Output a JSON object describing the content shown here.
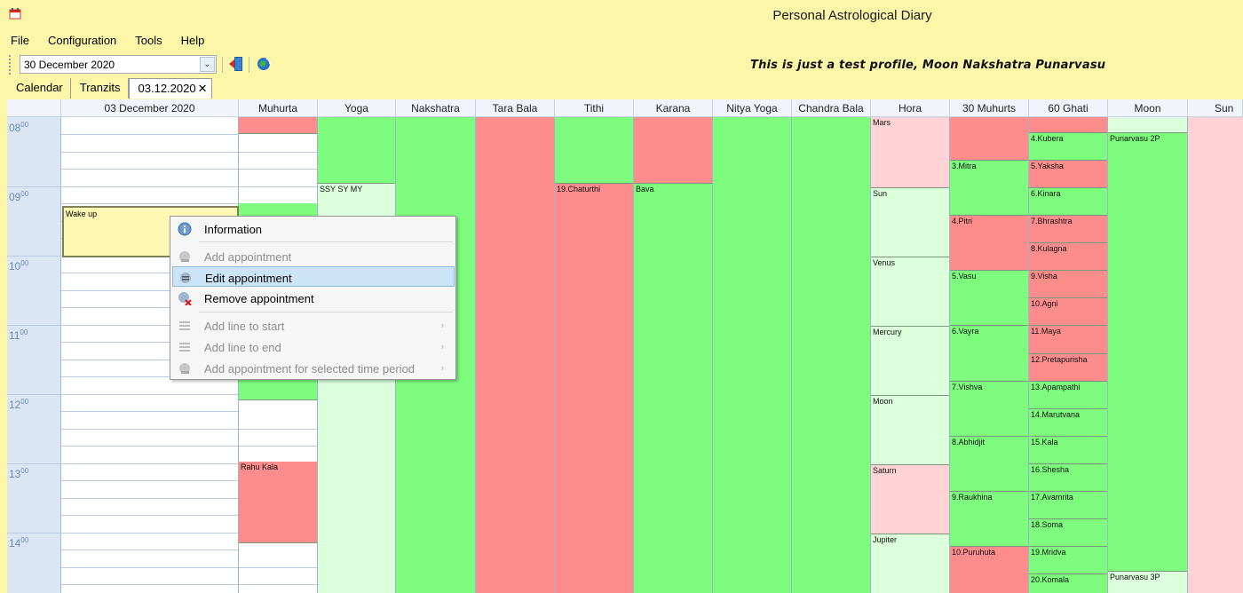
{
  "window": {
    "title": "Personal Astrological Diary"
  },
  "menu": [
    "File",
    "Configuration",
    "Tools",
    "Help"
  ],
  "toolbar": {
    "date_value": "30 December 2020",
    "drop_glyph": "⌄"
  },
  "profile_note": "This is just a test profile, Moon Nakshatra Punarvasu",
  "tabs": [
    {
      "label": "Calendar",
      "active": false
    },
    {
      "label": "Tranzits",
      "active": false
    },
    {
      "label": "03.12.2020",
      "active": true,
      "close": "✕"
    }
  ],
  "columns": {
    "date": "03 December 2020",
    "muhurta": "Muhurta",
    "yoga": "Yoga",
    "nakshatra": "Nakshatra",
    "tara_bala": "Tara Bala",
    "tithi": "Tithi",
    "karana": "Karana",
    "nitya_yoga": "Nitya Yoga",
    "chandra_bala": "Chandra Bala",
    "hora": "Hora",
    "muhurts_30": "30 Muhurts",
    "ghati_60": "60 Ghati",
    "moon": "Moon",
    "sun": "Sun"
  },
  "hours": [
    {
      "h": "08",
      "m": "00"
    },
    {
      "h": "09",
      "m": "00"
    },
    {
      "h": "10",
      "m": "00"
    },
    {
      "h": "11",
      "m": "00"
    },
    {
      "h": "12",
      "m": "00"
    },
    {
      "h": "13",
      "m": "00"
    },
    {
      "h": "14",
      "m": "00"
    }
  ],
  "appointment": {
    "label": "Wake up"
  },
  "cells": {
    "muhurta_rahu": "Rahu Kala",
    "yoga": "SSY SY MY",
    "tithi": "19.Chaturthi",
    "karana": "Bava",
    "hora": [
      "Mars",
      "Sun",
      "Venus",
      "Mercury",
      "Moon",
      "Saturn",
      "Jupiter"
    ],
    "muhurts": [
      "3.Mitra",
      "4.Pitri",
      "5.Vasu",
      "6.Vayra",
      "7.Vishva",
      "8.Abhidjit",
      "9.Raukhina",
      "10.Puruhuta"
    ],
    "ghati": [
      "4.Kubera",
      "5.Yaksha",
      "6.Kinara",
      "7.Bhrashtra",
      "8.Kulagna",
      "9.Visha",
      "10.Agni",
      "11.Maya",
      "12.Pretapurisha",
      "13.Apampathi",
      "14.Marutvana",
      "15.Kala",
      "16.Shesha",
      "17.Avamrita",
      "18.Soma",
      "19.Mridva",
      "20.Komala"
    ],
    "moon": [
      "Punarvasu 2P",
      "Punarvasu 3P"
    ]
  },
  "context_menu": {
    "information": "Information",
    "add_appointment": "Add appointment",
    "edit_appointment": "Edit appointment",
    "remove_appointment": "Remove appointment",
    "add_line_start": "Add line to start",
    "add_line_end": "Add line to end",
    "add_selected_period": "Add appointment for selected time period",
    "arrow": "›"
  },
  "colors": {
    "good": "#7dfc7d",
    "bad": "#fd8c8c",
    "light_good": "#dcffdc",
    "light_bad": "#ffd3d6",
    "window_bg": "#fbf6a8",
    "menu_hover": "#cce4f7"
  }
}
